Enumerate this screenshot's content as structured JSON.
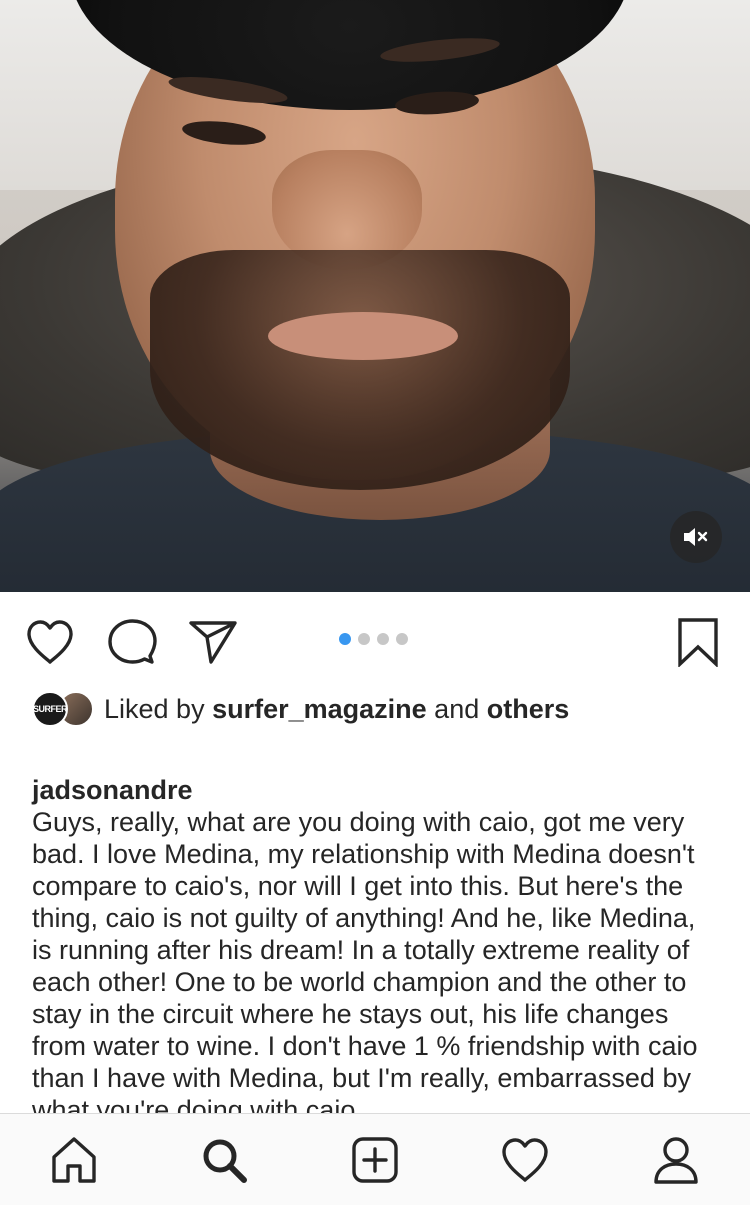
{
  "post": {
    "media": {
      "type": "video",
      "mute_icon": "speaker-muted-icon",
      "carousel_index": 1,
      "carousel_total": 4
    },
    "actions": {
      "like_icon": "heart-outline-icon",
      "comment_icon": "comment-bubble-icon",
      "share_icon": "paper-plane-icon",
      "save_icon": "bookmark-outline-icon"
    },
    "likes": {
      "avatar_badge": "SURFER",
      "prefix": "Liked by ",
      "first_liker": "surfer_magazine",
      "joiner": " and ",
      "others": "others"
    },
    "caption": {
      "username": "jadsonandre",
      "text": "Guys, really, what are you doing with caio, got me very bad. I love Medina, my relationship with Medina doesn't compare to caio's, nor will I get into this. But here's the thing, caio is not guilty of anything! And he, like Medina, is running after his dream! In a totally extreme reality of each other! One to be world champion and the other to stay in the circuit where he stays out, his life changes from water to wine. I don't have 1 % friendship with caio than I have with Medina, but I'm really, embarrassed by what you're doing with caio."
    }
  },
  "tabbar": {
    "items": [
      "home-icon",
      "search-icon",
      "new-post-icon",
      "activity-heart-icon",
      "profile-icon"
    ]
  },
  "colors": {
    "text": "#262626",
    "carousel_active": "#3897f0",
    "carousel_inactive": "#c7c7c7",
    "tabbar_bg": "#fafafa"
  }
}
